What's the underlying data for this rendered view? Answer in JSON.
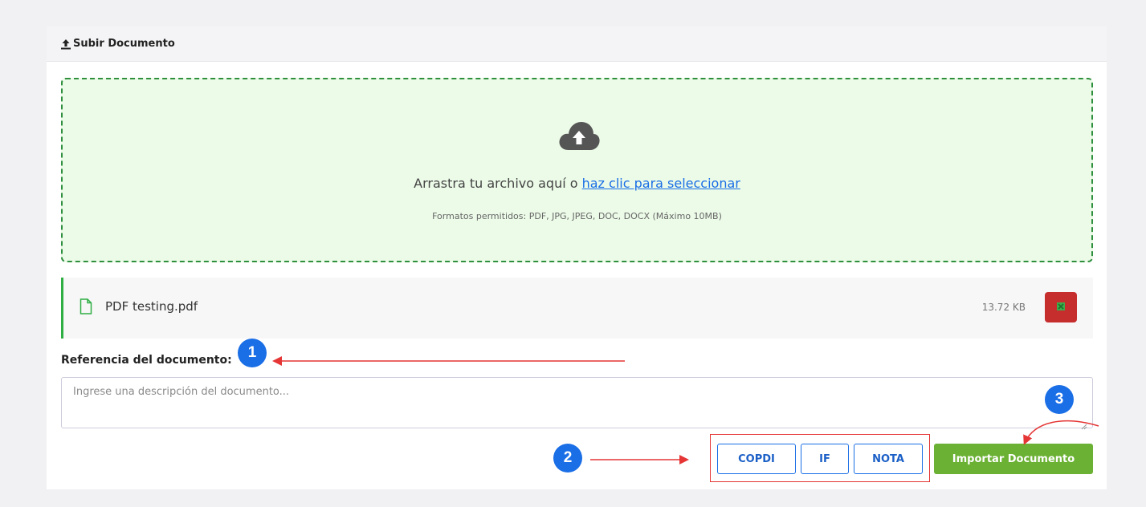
{
  "header": {
    "title": "Subir Documento",
    "icon": "upload-icon"
  },
  "dropzone": {
    "text": "Arrastra tu archivo aquí o ",
    "link": "haz clic para seleccionar",
    "formats": "Formatos permitidos: PDF, JPG, JPEG, DOC, DOCX (Máximo 10MB)",
    "icon": "cloud-upload-icon"
  },
  "file": {
    "name": "PDF testing.pdf",
    "size": "13.72 KB",
    "icon": "file-icon",
    "remove_icon": "close-icon"
  },
  "reference": {
    "label": "Referencia del documento:",
    "placeholder": "Ingrese una descripción del documento..."
  },
  "type_buttons": [
    {
      "label": "COPDI"
    },
    {
      "label": "IF"
    },
    {
      "label": "NOTA"
    }
  ],
  "import_button": {
    "label": "Importar Documento"
  },
  "annotations": [
    {
      "number": "1"
    },
    {
      "number": "2"
    },
    {
      "number": "3"
    }
  ],
  "colors": {
    "accent": "#1a6ee6",
    "drop_border": "#2e8f3c",
    "drop_bg": "#ecfbe8",
    "import": "#6bb133",
    "remove": "#c62e2e",
    "annotation": "#e53535"
  }
}
